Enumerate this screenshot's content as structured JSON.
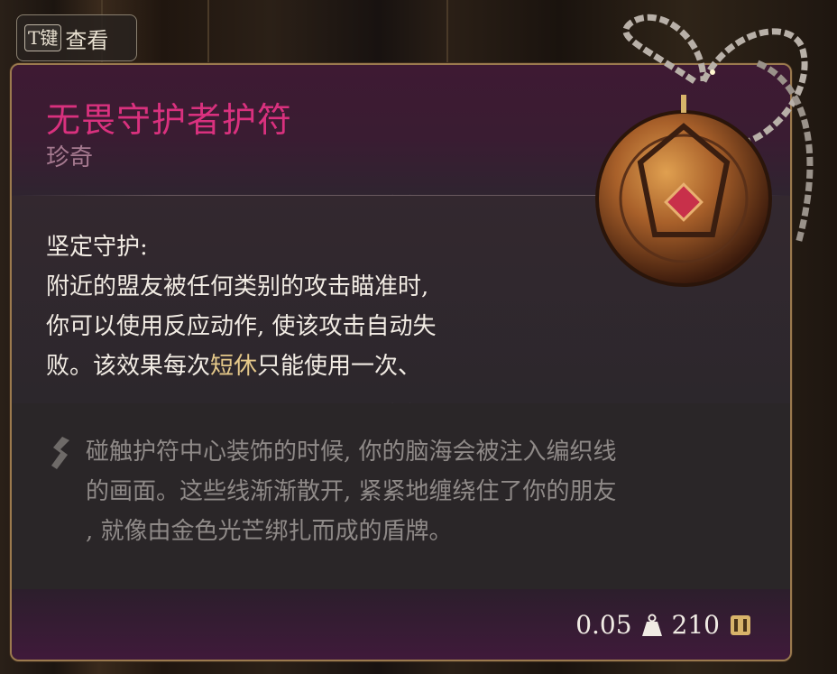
{
  "key_hint": {
    "key": "T键",
    "label": "查看"
  },
  "item": {
    "name": "无畏守护者护符",
    "rarity": "珍奇",
    "effect_title": "坚定守护:",
    "effect_lines": [
      "附近的盟友被任何类别的攻击瞄准时,",
      "你可以使用反应动作, 使该攻击自动失",
      "败。该效果每次"
    ],
    "effect_keyword": "短休",
    "effect_tail": "只能使用一次、",
    "flavor_lines": [
      "碰触护符中心装饰的时候, 你的脑海会被注入编织线",
      "的画面。这些线渐渐散开, 紧紧地缠绕住了你的朋友",
      ", 就像由金色光芒绑扎而成的盾牌。"
    ],
    "weight": "0.05",
    "value": "210",
    "colors": {
      "title": "#d9317e",
      "rarity": "#a67a90",
      "keyword": "#e6c98a",
      "flavor": "#8f8a88",
      "frame": "#9b7a4e"
    },
    "icons": [
      "amulet-image",
      "flavor-quill-icon",
      "weight-icon",
      "gold-icon"
    ]
  }
}
